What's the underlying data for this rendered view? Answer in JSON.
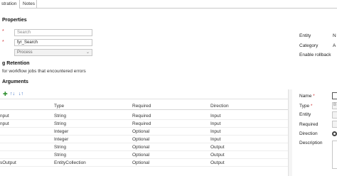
{
  "tabs": [
    {
      "label": "stration"
    },
    {
      "label": "Notes"
    }
  ],
  "properties": {
    "title": "Properties",
    "search_placeholder": "Search",
    "name_value": "fyr_Search",
    "category_value": "Process"
  },
  "retention": {
    "title": "g Retention",
    "text": "for workflow jobs that encountered errors"
  },
  "arguments": {
    "title": "Arguments",
    "toolbar_icons": [
      "add-icon",
      "move-up-icon",
      "move-down-icon"
    ],
    "columns": [
      "Type",
      "Required",
      "Direction"
    ],
    "rows": [
      {
        "name": "nput",
        "type": "String",
        "required": "Required",
        "direction": "Input"
      },
      {
        "name": "nput",
        "type": "String",
        "required": "Required",
        "direction": "Input"
      },
      {
        "name": "",
        "type": "Integer",
        "required": "Optional",
        "direction": "Input"
      },
      {
        "name": "",
        "type": "Integer",
        "required": "Optional",
        "direction": "Input"
      },
      {
        "name": "",
        "type": "String",
        "required": "Optional",
        "direction": "Output"
      },
      {
        "name": "",
        "type": "String",
        "required": "Optional",
        "direction": "Output"
      },
      {
        "name": "sOutput",
        "type": "EntityCollection",
        "required": "Optional",
        "direction": "Output"
      }
    ]
  },
  "right_panel": {
    "entity_label": "Entity",
    "entity_value": "N",
    "category_label": "Category",
    "category_value": "A",
    "rollback_label": "Enable rollback"
  },
  "detail_panel": {
    "name_label": "Name",
    "type_label": "Type",
    "type_value": "B",
    "entity_label": "Entity",
    "required_label": "Required",
    "direction_label": "Direction",
    "description_label": "Description"
  },
  "colors": {
    "required_marker": "#d13438",
    "border": "#c6c6c6"
  }
}
